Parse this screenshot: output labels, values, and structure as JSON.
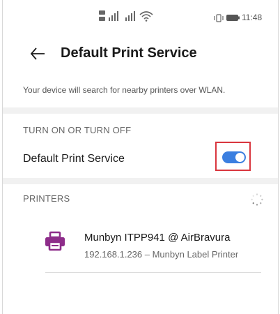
{
  "status_bar": {
    "time": "11:48",
    "icons": [
      "sim-signal-icon",
      "wifi-icon",
      "vibrate-icon",
      "battery-icon"
    ]
  },
  "header": {
    "back_icon": "back-arrow-icon",
    "title": "Default Print Service"
  },
  "description": "Your device will search for nearby printers over WLAN.",
  "toggle_section": {
    "header": "TURN ON OR TURN OFF",
    "label": "Default Print Service",
    "enabled": true,
    "accent_color": "#3b7fe0",
    "highlight_color": "#d9363e"
  },
  "printers_section": {
    "header": "PRINTERS",
    "loading_icon": "spinner-icon",
    "printers": [
      {
        "icon": "printer-icon",
        "icon_color": "#8e2d8a",
        "name": "Munbyn ITPP941 @ AirBravura",
        "subtitle": "192.168.1.236 – Munbyn Label Printer"
      }
    ]
  }
}
